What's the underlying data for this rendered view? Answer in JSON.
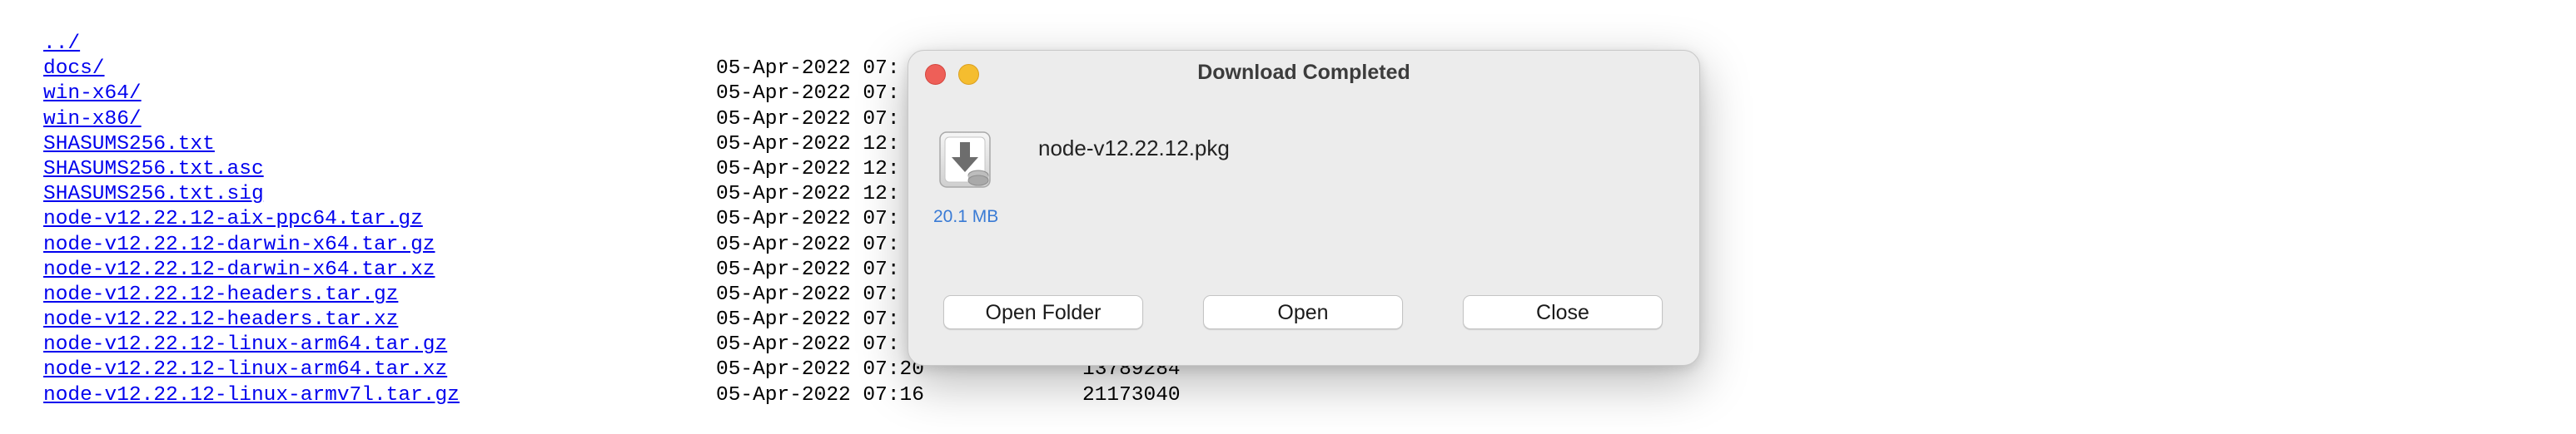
{
  "listing": {
    "rows": [
      {
        "name": "../",
        "date": "",
        "size": ""
      },
      {
        "name": "docs/",
        "date": "05-Apr-2022 07:",
        "size": ""
      },
      {
        "name": "win-x64/",
        "date": "05-Apr-2022 07:",
        "size": ""
      },
      {
        "name": "win-x86/",
        "date": "05-Apr-2022 07:",
        "size": ""
      },
      {
        "name": "SHASUMS256.txt",
        "date": "05-Apr-2022 12:",
        "size": ""
      },
      {
        "name": "SHASUMS256.txt.asc",
        "date": "05-Apr-2022 12:",
        "size": ""
      },
      {
        "name": "SHASUMS256.txt.sig",
        "date": "05-Apr-2022 12:",
        "size": ""
      },
      {
        "name": "node-v12.22.12-aix-ppc64.tar.gz",
        "date": "05-Apr-2022 07:",
        "size": ""
      },
      {
        "name": "node-v12.22.12-darwin-x64.tar.gz",
        "date": "05-Apr-2022 07:",
        "size": ""
      },
      {
        "name": "node-v12.22.12-darwin-x64.tar.xz",
        "date": "05-Apr-2022 07:",
        "size": ""
      },
      {
        "name": "node-v12.22.12-headers.tar.gz",
        "date": "05-Apr-2022 07:",
        "size": ""
      },
      {
        "name": "node-v12.22.12-headers.tar.xz",
        "date": "05-Apr-2022 07:",
        "size": ""
      },
      {
        "name": "node-v12.22.12-linux-arm64.tar.gz",
        "date": "05-Apr-2022 07:",
        "size": ""
      },
      {
        "name": "node-v12.22.12-linux-arm64.tar.xz",
        "date": "05-Apr-2022 07:20",
        "size": "13789284"
      },
      {
        "name": "node-v12.22.12-linux-armv7l.tar.gz",
        "date": "05-Apr-2022 07:16",
        "size": "21173040"
      }
    ]
  },
  "dialog": {
    "title": "Download Completed",
    "file_name": "node-v12.22.12.pkg",
    "file_size": "20.1 MB",
    "file_icon": "installer-package-icon",
    "buttons": {
      "open_folder": "Open Folder",
      "open": "Open",
      "close": "Close"
    }
  },
  "colors": {
    "link": "#0000ee",
    "dialog_bg": "#ececec",
    "close_light": "#ee5f58",
    "minimize_light": "#f5bd2f",
    "size_text": "#3a7bd5"
  }
}
